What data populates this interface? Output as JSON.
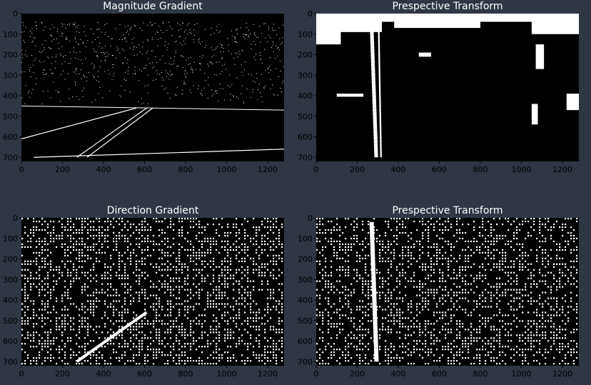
{
  "figure": {
    "background": "#2f3744",
    "text_color": "#ffffff",
    "tick_color": "#000000"
  },
  "chart_data": [
    {
      "type": "heatmap",
      "title": "Magnitude Gradient",
      "xlabel": "",
      "ylabel": "",
      "xlim": [
        0,
        1280
      ],
      "ylim": [
        720,
        0
      ],
      "xticks": [
        0,
        200,
        400,
        600,
        800,
        1000,
        1200
      ],
      "yticks": [
        0,
        100,
        200,
        300,
        400,
        500,
        600,
        700
      ],
      "colormap": "binary (black background, white edge pixels)",
      "grid": false
    },
    {
      "type": "heatmap",
      "title": "Prespective Transform",
      "xlabel": "",
      "ylabel": "",
      "xlim": [
        0,
        1280
      ],
      "ylim": [
        720,
        0
      ],
      "xticks": [
        0,
        200,
        400,
        600,
        800,
        1000,
        1200
      ],
      "yticks": [
        0,
        100,
        200,
        300,
        400,
        500,
        600,
        700
      ],
      "colormap": "binary (black background, white edge pixels)",
      "grid": false
    },
    {
      "type": "heatmap",
      "title": "Direction Gradient",
      "xlabel": "",
      "ylabel": "",
      "xlim": [
        0,
        1280
      ],
      "ylim": [
        720,
        0
      ],
      "xticks": [
        0,
        200,
        400,
        600,
        800,
        1000,
        1200
      ],
      "yticks": [
        0,
        100,
        200,
        300,
        400,
        500,
        600,
        700
      ],
      "colormap": "binary (black background, white noise pixels)",
      "grid": false
    },
    {
      "type": "heatmap",
      "title": "Prespective Transform",
      "xlabel": "",
      "ylabel": "",
      "xlim": [
        0,
        1280
      ],
      "ylim": [
        720,
        0
      ],
      "xticks": [
        0,
        200,
        400,
        600,
        800,
        1000,
        1200
      ],
      "yticks": [
        0,
        100,
        200,
        300,
        400,
        500,
        600,
        700
      ],
      "colormap": "binary (black background, white noise pixels)",
      "grid": false
    }
  ]
}
